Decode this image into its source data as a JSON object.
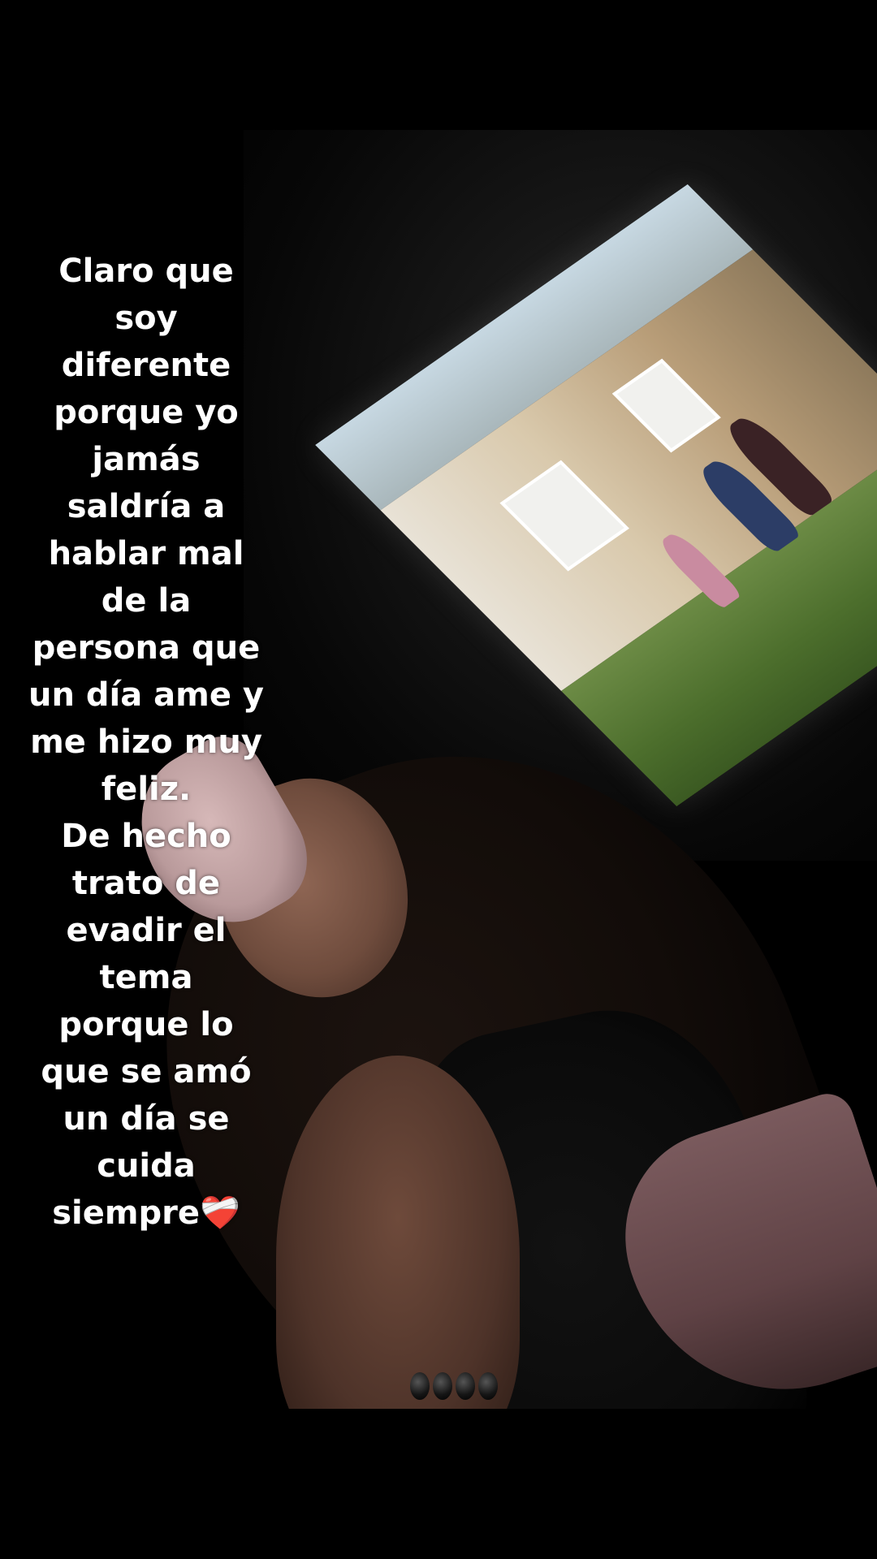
{
  "caption": {
    "lines": [
      "Claro que",
      "soy",
      "diferente",
      "porque yo",
      "jamás",
      "saldría a",
      "hablar mal",
      "de la",
      "persona que",
      "un día ame y",
      "me hizo muy",
      "feliz.",
      "De hecho",
      "trato de",
      "evadir el",
      "tema",
      "porque lo",
      "que se amó",
      "un día se",
      "cuida",
      "siempre❤️‍🩹"
    ]
  },
  "photo": {
    "background_color": "#000000",
    "subject": "selfie",
    "screen_scene": "house-lawn"
  }
}
